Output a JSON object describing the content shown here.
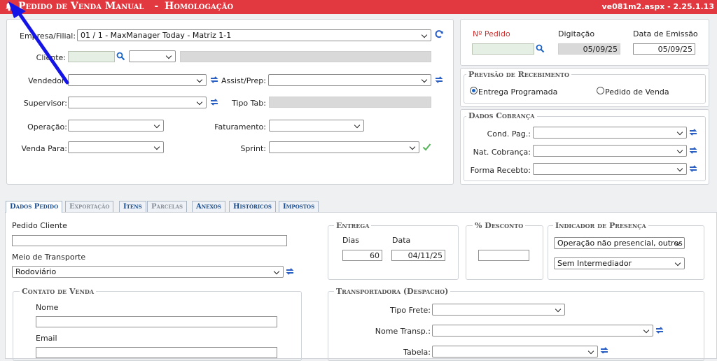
{
  "header": {
    "title": "Pedido de Venda Manual",
    "separator": "-",
    "environment": "Homologação",
    "version": "ve081m2.aspx - 2.25.1.13"
  },
  "form": {
    "empresa_label": "Empresa/Filial:",
    "empresa_value": "01 / 1 - MaxManager Today - Matriz 1-1",
    "cliente_label": "Cliente:",
    "cliente_code": "",
    "cliente_type": "",
    "cliente_name": "",
    "vendedor_label": "Vendedor:",
    "vendedor_value": "",
    "assist_label": "Assist/Prep:",
    "assist_value": "",
    "supervisor_label": "Supervisor:",
    "supervisor_value": "",
    "tipotab_label": "Tipo Tab:",
    "tipotab_value": "",
    "operacao_label": "Operação:",
    "operacao_value": "",
    "faturamento_label": "Faturamento:",
    "faturamento_value": "",
    "vendapara_label": "Venda Para:",
    "vendapara_value": "",
    "sprint_label": "Sprint:",
    "sprint_value": ""
  },
  "order": {
    "numero_label": "Nº Pedido",
    "numero_value": "",
    "digitacao_label": "Digitação",
    "digitacao_value": "05/09/25",
    "emissao_label": "Data de Emissão",
    "emissao_value": "05/09/25"
  },
  "previsao": {
    "legend": "Previsão de Recebimento",
    "option1": "Entrega Programada",
    "option2": "Pedido de Venda",
    "selected": "Entrega Programada"
  },
  "cobranca": {
    "legend": "Dados Cobrança",
    "cond_label": "Cond. Pag.:",
    "cond_value": "",
    "nat_label": "Nat. Cobrança:",
    "nat_value": "",
    "forma_label": "Forma Recebto:",
    "forma_value": ""
  },
  "tabs": {
    "t1": "Dados Pedido",
    "t2": "Exportação",
    "t3": "Itens",
    "t4": "Parcelas",
    "t5": "Anexos",
    "t6": "Históricos",
    "t7": "Impostos",
    "active": "Dados Pedido"
  },
  "dados_pedido": {
    "pedido_cliente_label": "Pedido Cliente",
    "pedido_cliente_value": "",
    "meio_label": "Meio de Transporte",
    "meio_value": "Rodoviário",
    "contato_legend": "Contato de Venda",
    "nome_label": "Nome",
    "nome_value": "",
    "email_label": "Email",
    "email_value": ""
  },
  "entrega": {
    "legend": "Entrega",
    "dias_label": "Dias",
    "dias_value": "60",
    "data_label": "Data",
    "data_value": "04/11/25"
  },
  "desconto": {
    "legend": "% Desconto",
    "value": ""
  },
  "presenca": {
    "legend": "Indicador de Presença",
    "option1": "Operação não presencial, outros",
    "option2": "Sem Intermediador"
  },
  "transportadora": {
    "legend": "Transportadora (Despacho)",
    "frete_label": "Tipo Frete:",
    "frete_value": "",
    "nome_label": "Nome Transp.:",
    "nome_value": "",
    "tabela_label": "Tabela:",
    "tabela_value": ""
  },
  "icons": {
    "bell": "bell-icon",
    "search": "search-icon",
    "refresh": "refresh-icon",
    "check": "check-icon",
    "arrow": "annotation-arrow"
  },
  "colors": {
    "header": "#e2383f",
    "accent": "#1a4d8f",
    "refresh": "#2b5fc4",
    "arrow": "#1414e6",
    "check": "#55b35a",
    "required": "#d32f2f"
  }
}
